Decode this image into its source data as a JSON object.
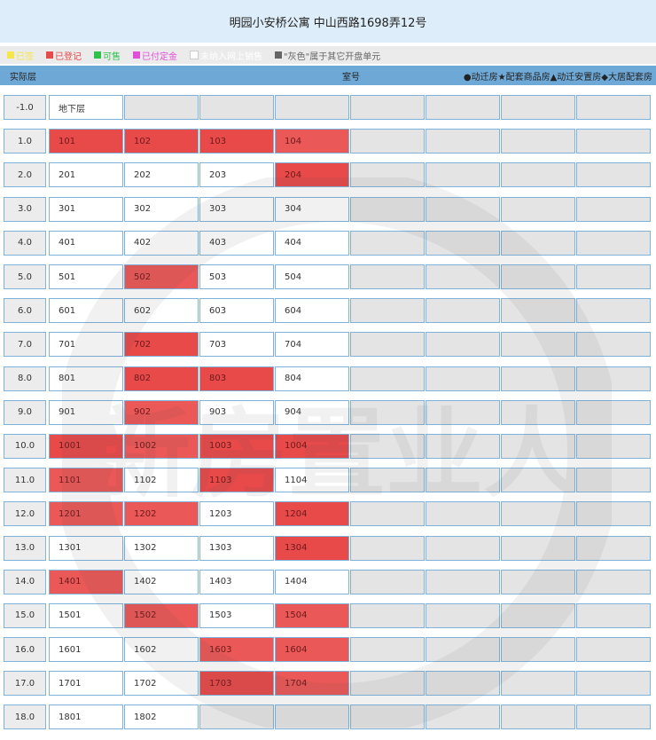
{
  "title": "明园小安桥公寓 中山西路1698弄12号",
  "legend": [
    {
      "label": "已签",
      "color": "#f5e64a"
    },
    {
      "label": "已登记",
      "color": "#e84a4a"
    },
    {
      "label": "可售",
      "color": "#2fc24a"
    },
    {
      "label": "已付定金",
      "color": "#e050d8"
    },
    {
      "label": "未纳入网上销售",
      "color": "#ffffff"
    },
    {
      "label": "\"灰色\"属于其它开盘单元",
      "color": "#666666"
    }
  ],
  "header": {
    "floor": "实际层",
    "room": "室号",
    "types": "●动迁房★配套商品房▲动迁安置房◆大居配套房"
  },
  "floors": [
    {
      "floor": "-1.0",
      "rooms": [
        {
          "no": "地下层",
          "s": "avail"
        }
      ]
    },
    {
      "floor": "1.0",
      "rooms": [
        {
          "no": "101",
          "s": "reg"
        },
        {
          "no": "102",
          "s": "reg"
        },
        {
          "no": "103",
          "s": "reg"
        },
        {
          "no": "104",
          "s": "reg2"
        }
      ]
    },
    {
      "floor": "2.0",
      "rooms": [
        {
          "no": "201",
          "s": "avail"
        },
        {
          "no": "202",
          "s": "avail"
        },
        {
          "no": "203",
          "s": "avail"
        },
        {
          "no": "204",
          "s": "reg"
        }
      ]
    },
    {
      "floor": "3.0",
      "rooms": [
        {
          "no": "301",
          "s": "avail"
        },
        {
          "no": "302",
          "s": "avail"
        },
        {
          "no": "303",
          "s": "avail"
        },
        {
          "no": "304",
          "s": "avail"
        }
      ]
    },
    {
      "floor": "4.0",
      "rooms": [
        {
          "no": "401",
          "s": "avail"
        },
        {
          "no": "402",
          "s": "avail"
        },
        {
          "no": "403",
          "s": "avail"
        },
        {
          "no": "404",
          "s": "avail"
        }
      ]
    },
    {
      "floor": "5.0",
      "rooms": [
        {
          "no": "501",
          "s": "avail"
        },
        {
          "no": "502",
          "s": "reg2"
        },
        {
          "no": "503",
          "s": "avail"
        },
        {
          "no": "504",
          "s": "avail"
        }
      ]
    },
    {
      "floor": "6.0",
      "rooms": [
        {
          "no": "601",
          "s": "avail"
        },
        {
          "no": "602",
          "s": "avail"
        },
        {
          "no": "603",
          "s": "avail"
        },
        {
          "no": "604",
          "s": "avail"
        }
      ]
    },
    {
      "floor": "7.0",
      "rooms": [
        {
          "no": "701",
          "s": "avail"
        },
        {
          "no": "702",
          "s": "reg"
        },
        {
          "no": "703",
          "s": "avail"
        },
        {
          "no": "704",
          "s": "avail"
        }
      ]
    },
    {
      "floor": "8.0",
      "rooms": [
        {
          "no": "801",
          "s": "avail"
        },
        {
          "no": "802",
          "s": "reg"
        },
        {
          "no": "803",
          "s": "reg"
        },
        {
          "no": "804",
          "s": "avail"
        }
      ]
    },
    {
      "floor": "9.0",
      "rooms": [
        {
          "no": "901",
          "s": "avail"
        },
        {
          "no": "902",
          "s": "reg2"
        },
        {
          "no": "903",
          "s": "avail"
        },
        {
          "no": "904",
          "s": "avail"
        }
      ]
    },
    {
      "floor": "10.0",
      "rooms": [
        {
          "no": "1001",
          "s": "reg"
        },
        {
          "no": "1002",
          "s": "reg2"
        },
        {
          "no": "1003",
          "s": "reg"
        },
        {
          "no": "1004",
          "s": "reg"
        }
      ]
    },
    {
      "floor": "11.0",
      "rooms": [
        {
          "no": "1101",
          "s": "reg2"
        },
        {
          "no": "1102",
          "s": "avail"
        },
        {
          "no": "1103",
          "s": "reg"
        },
        {
          "no": "1104",
          "s": "avail"
        }
      ]
    },
    {
      "floor": "12.0",
      "rooms": [
        {
          "no": "1201",
          "s": "reg2"
        },
        {
          "no": "1202",
          "s": "reg2"
        },
        {
          "no": "1203",
          "s": "avail"
        },
        {
          "no": "1204",
          "s": "reg"
        }
      ]
    },
    {
      "floor": "13.0",
      "rooms": [
        {
          "no": "1301",
          "s": "avail"
        },
        {
          "no": "1302",
          "s": "avail"
        },
        {
          "no": "1303",
          "s": "avail"
        },
        {
          "no": "1304",
          "s": "reg"
        }
      ]
    },
    {
      "floor": "14.0",
      "rooms": [
        {
          "no": "1401",
          "s": "reg2"
        },
        {
          "no": "1402",
          "s": "avail"
        },
        {
          "no": "1403",
          "s": "avail"
        },
        {
          "no": "1404",
          "s": "avail"
        }
      ]
    },
    {
      "floor": "15.0",
      "rooms": [
        {
          "no": "1501",
          "s": "avail"
        },
        {
          "no": "1502",
          "s": "reg2"
        },
        {
          "no": "1503",
          "s": "avail"
        },
        {
          "no": "1504",
          "s": "reg2"
        }
      ]
    },
    {
      "floor": "16.0",
      "rooms": [
        {
          "no": "1601",
          "s": "avail"
        },
        {
          "no": "1602",
          "s": "avail"
        },
        {
          "no": "1603",
          "s": "reg2"
        },
        {
          "no": "1604",
          "s": "reg2"
        }
      ]
    },
    {
      "floor": "17.0",
      "rooms": [
        {
          "no": "1701",
          "s": "avail"
        },
        {
          "no": "1702",
          "s": "avail"
        },
        {
          "no": "1703",
          "s": "reg"
        },
        {
          "no": "1704",
          "s": "reg2"
        }
      ]
    },
    {
      "floor": "18.0",
      "rooms": [
        {
          "no": "1801",
          "s": "avail"
        },
        {
          "no": "1802",
          "s": "avail"
        }
      ]
    }
  ],
  "watermark_text": "新房置业人"
}
